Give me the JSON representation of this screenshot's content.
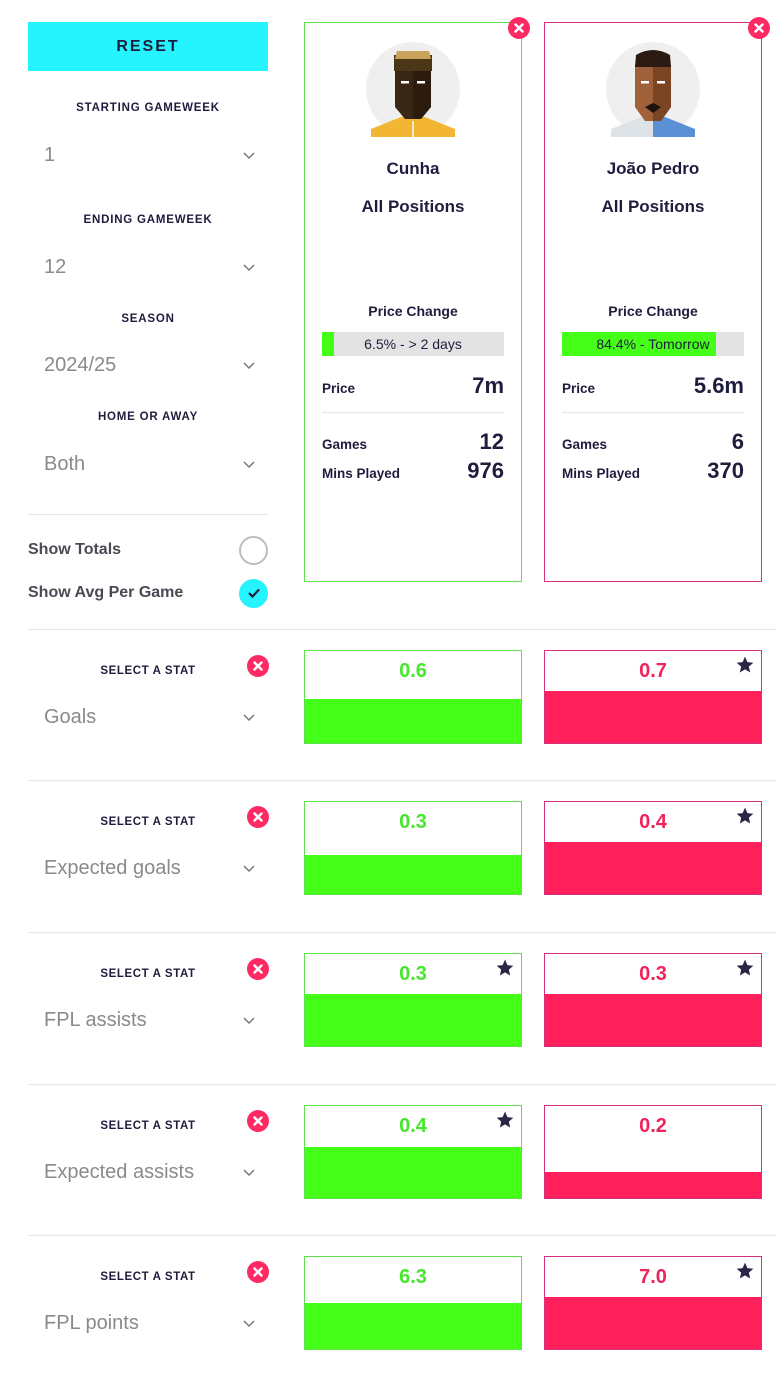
{
  "controls": {
    "reset_label": "RESET",
    "filters": [
      {
        "label": "STARTING GAMEWEEK",
        "value": "1"
      },
      {
        "label": "ENDING GAMEWEEK",
        "value": "12"
      },
      {
        "label": "SEASON",
        "value": "2024/25"
      },
      {
        "label": "HOME OR AWAY",
        "value": "Both"
      }
    ],
    "toggles": [
      {
        "label": "Show Totals",
        "checked": false
      },
      {
        "label": "Show Avg Per Game",
        "checked": true
      }
    ]
  },
  "colors": {
    "accent": "#25f4ff",
    "player1": "#45ff18",
    "player1_border": "#5ee04a",
    "player2": "#ff1f5a",
    "player2_border": "#d6317e",
    "close": "#ff2a63",
    "text_dark": "#1f1d3d"
  },
  "players": [
    {
      "name": "Cunha",
      "position": "All Positions",
      "shirt_color": "#f2b632",
      "price_change_title": "Price Change",
      "price_change_text": "6.5% - > 2 days",
      "price_change_pct": 6.5,
      "price_label": "Price",
      "price": "7m",
      "games_label": "Games",
      "games": "12",
      "mins_label": "Mins Played",
      "mins": "976"
    },
    {
      "name": "João Pedro",
      "position": "All Positions",
      "shirt_color": "#5b8fd6",
      "price_change_title": "Price Change",
      "price_change_text": "84.4% - Tomorrow",
      "price_change_pct": 84.4,
      "price_label": "Price",
      "price": "5.6m",
      "games_label": "Games",
      "games": "6",
      "mins_label": "Mins Played",
      "mins": "370"
    }
  ],
  "stats": [
    {
      "select_label": "SELECT A STAT",
      "stat": "Goals",
      "values": [
        "0.6",
        "0.7"
      ],
      "fill": [
        0.48,
        0.56
      ],
      "star": [
        false,
        true
      ]
    },
    {
      "select_label": "SELECT A STAT",
      "stat": "Expected goals",
      "values": [
        "0.3",
        "0.4"
      ],
      "fill": [
        0.42,
        0.56
      ],
      "star": [
        false,
        true
      ]
    },
    {
      "select_label": "SELECT A STAT",
      "stat": "FPL assists",
      "values": [
        "0.3",
        "0.3"
      ],
      "fill": [
        0.56,
        0.56
      ],
      "star": [
        true,
        true
      ]
    },
    {
      "select_label": "SELECT A STAT",
      "stat": "Expected assists",
      "values": [
        "0.4",
        "0.2"
      ],
      "fill": [
        0.55,
        0.28
      ],
      "star": [
        true,
        false
      ]
    },
    {
      "select_label": "SELECT A STAT",
      "stat": "FPL points",
      "values": [
        "6.3",
        "7.0"
      ],
      "fill": [
        0.5,
        0.56
      ],
      "star": [
        false,
        true
      ]
    }
  ]
}
